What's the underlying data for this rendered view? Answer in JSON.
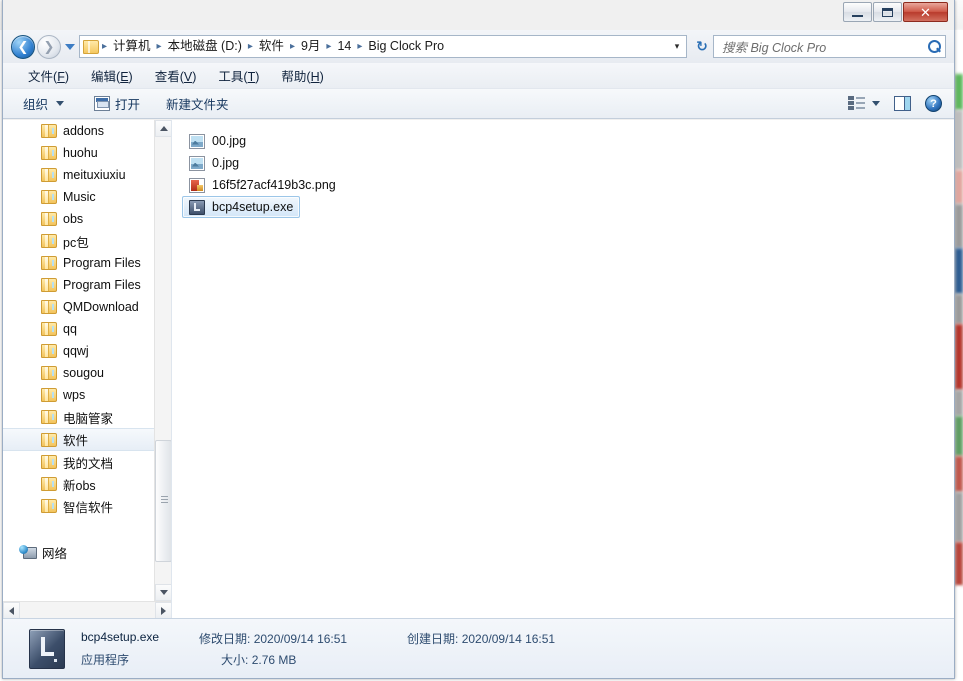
{
  "window": {
    "title_obscured": true,
    "caption_buttons": [
      {
        "name": "minimize",
        "label": "–"
      },
      {
        "name": "maximize",
        "label": "□"
      },
      {
        "name": "close",
        "label": "✕"
      }
    ]
  },
  "backdrop": {
    "accent_green": "#4cb963",
    "blurred_labels": [
      "",
      "",
      "",
      "",
      "",
      ""
    ]
  },
  "addressbar": {
    "back_glyph": "←",
    "forward_glyph": "→",
    "history_caret": "",
    "crumbs": [
      "计算机",
      "本地磁盘 (D:)",
      "软件",
      "9月",
      "14",
      "Big Clock Pro"
    ],
    "separator": "▸",
    "dropdown_caret": "▾",
    "refresh_glyph": "↻"
  },
  "search": {
    "placeholder": "搜索 Big Clock Pro",
    "value": ""
  },
  "menubar": {
    "items": [
      {
        "text": "文件",
        "key": "F"
      },
      {
        "text": "编辑",
        "key": "E"
      },
      {
        "text": "查看",
        "key": "V"
      },
      {
        "text": "工具",
        "key": "T"
      },
      {
        "text": "帮助",
        "key": "H"
      }
    ]
  },
  "toolbar": {
    "organize_label": "组织",
    "open_label": "打开",
    "new_folder_label": "新建文件夹",
    "help_glyph": "?"
  },
  "navpane": {
    "items": [
      {
        "label": "addons",
        "icon": "folder-icon",
        "selected": false
      },
      {
        "label": "huohu",
        "icon": "folder-icon",
        "selected": false
      },
      {
        "label": "meituxiuxiu",
        "icon": "folder-icon",
        "selected": false
      },
      {
        "label": "Music",
        "icon": "folder-icon",
        "selected": false
      },
      {
        "label": "obs",
        "icon": "folder-icon",
        "selected": false
      },
      {
        "label": "pc包",
        "icon": "folder-icon",
        "selected": false
      },
      {
        "label": "Program Files",
        "icon": "folder-icon",
        "selected": false
      },
      {
        "label": "Program Files",
        "icon": "folder-icon",
        "selected": false
      },
      {
        "label": "QMDownload",
        "icon": "folder-icon",
        "selected": false
      },
      {
        "label": "qq",
        "icon": "folder-icon",
        "selected": false
      },
      {
        "label": "qqwj",
        "icon": "folder-icon",
        "selected": false
      },
      {
        "label": "sougou",
        "icon": "folder-icon",
        "selected": false
      },
      {
        "label": "wps",
        "icon": "folder-icon",
        "selected": false
      },
      {
        "label": "电脑管家",
        "icon": "folder-icon",
        "selected": false
      },
      {
        "label": "软件",
        "icon": "folder-icon",
        "selected": true
      },
      {
        "label": "我的文档",
        "icon": "folder-icon",
        "selected": false
      },
      {
        "label": "新obs",
        "icon": "folder-icon",
        "selected": false
      },
      {
        "label": "智信软件",
        "icon": "folder-icon",
        "selected": false
      }
    ],
    "network_label": "网络"
  },
  "filelist": {
    "items": [
      {
        "name": "00.jpg",
        "icon": "image-file-icon",
        "type": "jpg",
        "selected": false
      },
      {
        "name": "0.jpg",
        "icon": "image-file-icon",
        "type": "jpg",
        "selected": false
      },
      {
        "name": "16f5f27acf419b3c.png",
        "icon": "png-file-icon",
        "type": "png",
        "selected": false
      },
      {
        "name": "bcp4setup.exe",
        "icon": "application-file-icon",
        "type": "exe",
        "selected": true
      }
    ]
  },
  "details": {
    "filename": "bcp4setup.exe",
    "filetype": "应用程序",
    "modified_label": "修改日期:",
    "modified_value": "2020/09/14 16:51",
    "created_label": "创建日期:",
    "created_value": "2020/09/14 16:51",
    "size_label": "大小:",
    "size_value": "2.76 MB"
  }
}
